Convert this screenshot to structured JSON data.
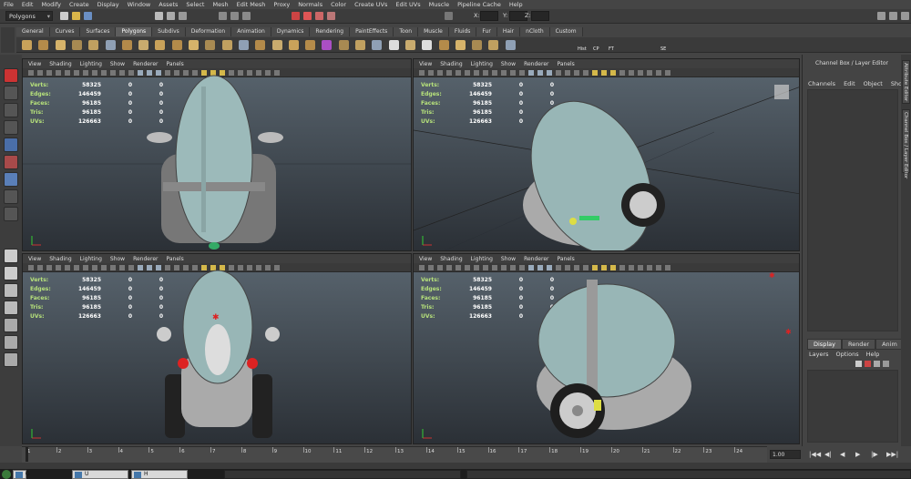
{
  "menubar": [
    "File",
    "Edit",
    "Modify",
    "Create",
    "Display",
    "Window",
    "Assets",
    "Select",
    "Mesh",
    "Edit Mesh",
    "Proxy",
    "Normals",
    "Color",
    "Create UVs",
    "Edit UVs",
    "Muscle",
    "Pipeline Cache",
    "Help"
  ],
  "status": {
    "mode": "Polygons",
    "x_label": "X:",
    "y_label": "Y:",
    "z_label": "Z:"
  },
  "shelf_tabs": [
    "General",
    "Curves",
    "Surfaces",
    "Polygons",
    "Subdivs",
    "Deformation",
    "Animation",
    "Dynamics",
    "Rendering",
    "PaintEffects",
    "Toon",
    "Muscle",
    "Fluids",
    "Fur",
    "Hair",
    "nCloth",
    "Custom"
  ],
  "shelf_active": "Polygons",
  "shelf_labels": {
    "hist": "Hist",
    "cp": "CP",
    "ft": "FT",
    "se": "SE"
  },
  "viewport_menu": [
    "View",
    "Shading",
    "Lighting",
    "Show",
    "Renderer",
    "Panels"
  ],
  "hud": {
    "labels": [
      "Verts:",
      "Edges:",
      "Faces:",
      "Tris:",
      "UVs:"
    ],
    "col1": [
      "58325",
      "146459",
      "96185",
      "96185",
      "126663"
    ],
    "col2": [
      "0",
      "0",
      "0",
      "0",
      "0"
    ],
    "col3": [
      "0",
      "0",
      "0",
      "0",
      "0"
    ]
  },
  "channel_box": {
    "title": "Channel Box / Layer Editor",
    "menu": [
      "Channels",
      "Edit",
      "Object",
      "Show"
    ]
  },
  "layer_editor": {
    "tabs": [
      "Display",
      "Render",
      "Anim"
    ],
    "menu": [
      "Layers",
      "Options",
      "Help"
    ]
  },
  "side_tabs": [
    "Attribute Editor",
    "Channel Box / Layer Editor"
  ],
  "timeline": {
    "ticks": [
      "1",
      "2",
      "3",
      "4",
      "5",
      "6",
      "7",
      "8",
      "9",
      "10",
      "11",
      "12",
      "13",
      "14",
      "15",
      "16",
      "17",
      "18",
      "19",
      "20",
      "21",
      "22",
      "23",
      "24"
    ],
    "current_frame": "1.00"
  },
  "playback": [
    "|◀◀",
    "◀|",
    "◀",
    "▶",
    "|▶",
    "▶▶|"
  ],
  "taskbar": [
    "G",
    "U",
    "H"
  ],
  "colors": {
    "accent": "#5d8ab8",
    "car_body": "#8fb0b0",
    "hud_green": "#b7e27b"
  }
}
